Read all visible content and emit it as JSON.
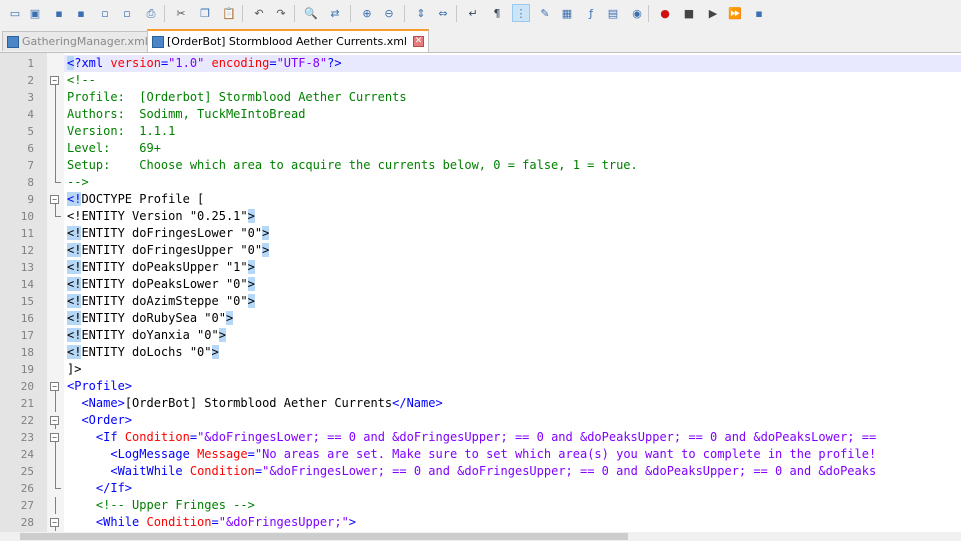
{
  "toolbar": {
    "icons": [
      "new-file-icon",
      "open-file-icon",
      "save-icon",
      "save-all-icon",
      "close-icon",
      "close-all-icon",
      "print-icon",
      "cut-icon",
      "copy-icon",
      "paste-icon",
      "undo-icon",
      "redo-icon",
      "find-icon",
      "replace-icon",
      "zoom-in-icon",
      "zoom-out-icon",
      "sync-vertical-icon",
      "sync-horizontal-icon",
      "word-wrap-icon",
      "show-all-chars-icon",
      "indent-guide-icon",
      "language-icon",
      "doc-map-icon",
      "function-list-icon",
      "folder-workspace-icon",
      "monitoring-icon",
      "record-macro-icon",
      "stop-record-icon",
      "play-macro-icon",
      "run-macro-multiple-icon",
      "save-macro-icon"
    ]
  },
  "tabs": [
    {
      "label": "GatheringManager.xml",
      "active": false
    },
    {
      "label": "[OrderBot] Stormblood Aether Currents.xml",
      "active": true
    }
  ],
  "editor": {
    "lines": [
      {
        "n": "1",
        "fold": "",
        "segs": [
          {
            "c": "c-tag hl",
            "t": "<"
          },
          {
            "c": "c-tag",
            "t": "?xml "
          },
          {
            "c": "c-attr",
            "t": "version"
          },
          {
            "c": "c-tag",
            "t": "="
          },
          {
            "c": "c-val",
            "t": "\"1.0\""
          },
          {
            "c": "c-tag",
            "t": " "
          },
          {
            "c": "c-attr",
            "t": "encoding"
          },
          {
            "c": "c-tag",
            "t": "="
          },
          {
            "c": "c-val",
            "t": "\"UTF-8\""
          },
          {
            "c": "c-tag",
            "t": "?>"
          }
        ]
      },
      {
        "n": "2",
        "fold": "open",
        "segs": [
          {
            "c": "c-cmt",
            "t": "<!--"
          }
        ]
      },
      {
        "n": "3",
        "fold": "line",
        "segs": [
          {
            "c": "c-cmt",
            "t": "Profile:  [Orderbot] Stormblood Aether Currents"
          }
        ]
      },
      {
        "n": "4",
        "fold": "line",
        "segs": [
          {
            "c": "c-cmt",
            "t": "Authors:  Sodimm, TuckMeIntoBread"
          }
        ]
      },
      {
        "n": "5",
        "fold": "line",
        "segs": [
          {
            "c": "c-cmt",
            "t": "Version:  1.1.1"
          }
        ]
      },
      {
        "n": "6",
        "fold": "line",
        "segs": [
          {
            "c": "c-cmt",
            "t": "Level:    69+"
          }
        ]
      },
      {
        "n": "7",
        "fold": "line",
        "segs": [
          {
            "c": "c-cmt",
            "t": "Setup:    Choose which area to acquire the currents below, 0 = false, 1 = true."
          }
        ]
      },
      {
        "n": "8",
        "fold": "end",
        "segs": [
          {
            "c": "c-cmt",
            "t": "-->"
          }
        ]
      },
      {
        "n": "9",
        "fold": "open",
        "segs": [
          {
            "c": "c-tag hl",
            "t": "<!"
          },
          {
            "c": "c-txt",
            "t": "DOCTYPE Profile ["
          }
        ]
      },
      {
        "n": "10",
        "fold": "end",
        "segs": [
          {
            "c": "c-txt",
            "t": "<!ENTITY Version \"0.25.1\""
          },
          {
            "c": "c-txt hl",
            "t": ">"
          }
        ]
      },
      {
        "n": "11",
        "fold": "",
        "segs": [
          {
            "c": "c-txt hl",
            "t": "<!"
          },
          {
            "c": "c-txt",
            "t": "ENTITY doFringesLower \"0\""
          },
          {
            "c": "c-txt hl",
            "t": ">"
          }
        ]
      },
      {
        "n": "12",
        "fold": "",
        "segs": [
          {
            "c": "c-txt hl",
            "t": "<!"
          },
          {
            "c": "c-txt",
            "t": "ENTITY doFringesUpper \"0\""
          },
          {
            "c": "c-txt hl",
            "t": ">"
          }
        ]
      },
      {
        "n": "13",
        "fold": "",
        "segs": [
          {
            "c": "c-txt hl",
            "t": "<!"
          },
          {
            "c": "c-txt",
            "t": "ENTITY doPeaksUpper \"1\""
          },
          {
            "c": "c-txt hl",
            "t": ">"
          }
        ]
      },
      {
        "n": "14",
        "fold": "",
        "segs": [
          {
            "c": "c-txt hl",
            "t": "<!"
          },
          {
            "c": "c-txt",
            "t": "ENTITY doPeaksLower \"0\""
          },
          {
            "c": "c-txt hl",
            "t": ">"
          }
        ]
      },
      {
        "n": "15",
        "fold": "",
        "segs": [
          {
            "c": "c-txt hl",
            "t": "<!"
          },
          {
            "c": "c-txt",
            "t": "ENTITY doAzimSteppe \"0\""
          },
          {
            "c": "c-txt hl",
            "t": ">"
          }
        ]
      },
      {
        "n": "16",
        "fold": "",
        "segs": [
          {
            "c": "c-txt hl",
            "t": "<!"
          },
          {
            "c": "c-txt",
            "t": "ENTITY doRubySea \"0\""
          },
          {
            "c": "c-txt hl",
            "t": ">"
          }
        ]
      },
      {
        "n": "17",
        "fold": "",
        "segs": [
          {
            "c": "c-txt hl",
            "t": "<!"
          },
          {
            "c": "c-txt",
            "t": "ENTITY doYanxia \"0\""
          },
          {
            "c": "c-txt hl",
            "t": ">"
          }
        ]
      },
      {
        "n": "18",
        "fold": "",
        "segs": [
          {
            "c": "c-txt hl",
            "t": "<!"
          },
          {
            "c": "c-txt",
            "t": "ENTITY doLochs \"0\""
          },
          {
            "c": "c-txt hl",
            "t": ">"
          }
        ]
      },
      {
        "n": "19",
        "fold": "",
        "segs": [
          {
            "c": "c-txt",
            "t": "]>"
          }
        ]
      },
      {
        "n": "20",
        "fold": "open",
        "segs": [
          {
            "c": "c-tag",
            "t": "<Profile>"
          }
        ]
      },
      {
        "n": "21",
        "fold": "line",
        "segs": [
          {
            "c": "c-txt",
            "t": "  "
          },
          {
            "c": "c-tag",
            "t": "<Name>"
          },
          {
            "c": "c-txt",
            "t": "[OrderBot] Stormblood Aether Currents"
          },
          {
            "c": "c-tag",
            "t": "</Name>"
          }
        ]
      },
      {
        "n": "22",
        "fold": "open",
        "segs": [
          {
            "c": "c-txt",
            "t": "  "
          },
          {
            "c": "c-tag",
            "t": "<Order>"
          }
        ]
      },
      {
        "n": "23",
        "fold": "open",
        "segs": [
          {
            "c": "c-txt",
            "t": "    "
          },
          {
            "c": "c-tag",
            "t": "<If "
          },
          {
            "c": "c-attr",
            "t": "Condition"
          },
          {
            "c": "c-tag",
            "t": "="
          },
          {
            "c": "c-val",
            "t": "\"&doFringesLower; == 0 and &doFringesUpper; == 0 and &doPeaksUpper; == 0 and &doPeaksLower; == "
          }
        ]
      },
      {
        "n": "24",
        "fold": "line",
        "segs": [
          {
            "c": "c-txt",
            "t": "      "
          },
          {
            "c": "c-tag",
            "t": "<LogMessage "
          },
          {
            "c": "c-attr",
            "t": "Message"
          },
          {
            "c": "c-tag",
            "t": "="
          },
          {
            "c": "c-val",
            "t": "\"No areas are set. Make sure to set which area(s) you want to complete in the profile!"
          }
        ]
      },
      {
        "n": "25",
        "fold": "line",
        "segs": [
          {
            "c": "c-txt",
            "t": "      "
          },
          {
            "c": "c-tag",
            "t": "<WaitWhile "
          },
          {
            "c": "c-attr",
            "t": "Condition"
          },
          {
            "c": "c-tag",
            "t": "="
          },
          {
            "c": "c-val",
            "t": "\"&doFringesLower; == 0 and &doFringesUpper; == 0 and &doPeaksUpper; == 0 and &doPeaks"
          }
        ]
      },
      {
        "n": "26",
        "fold": "end",
        "segs": [
          {
            "c": "c-txt",
            "t": "    "
          },
          {
            "c": "c-tag",
            "t": "</If>"
          }
        ]
      },
      {
        "n": "27",
        "fold": "line",
        "segs": [
          {
            "c": "c-txt",
            "t": "    "
          },
          {
            "c": "c-cmt",
            "t": "<!-- Upper Fringes -->"
          }
        ]
      },
      {
        "n": "28",
        "fold": "open",
        "segs": [
          {
            "c": "c-txt",
            "t": "    "
          },
          {
            "c": "c-tag",
            "t": "<While "
          },
          {
            "c": "c-attr",
            "t": "Condition"
          },
          {
            "c": "c-tag",
            "t": "="
          },
          {
            "c": "c-val",
            "t": "\"&doFringesUpper;\""
          },
          {
            "c": "c-tag",
            "t": ">"
          }
        ]
      }
    ]
  }
}
